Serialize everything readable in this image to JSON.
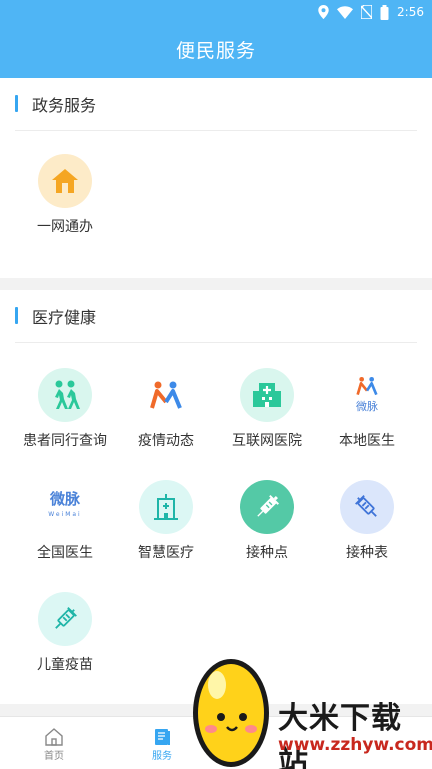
{
  "status": {
    "time": "2:56"
  },
  "header": {
    "title": "便民服务"
  },
  "sections": {
    "gov": {
      "title": "政务服务",
      "items": [
        {
          "label": "一网通办",
          "icon": "home-icon"
        }
      ]
    },
    "med": {
      "title": "医疗健康",
      "items": [
        {
          "label": "患者同行查询",
          "icon": "walking-people-icon"
        },
        {
          "label": "疫情动态",
          "icon": "people-logo-icon"
        },
        {
          "label": "互联网医院",
          "icon": "hospital-icon"
        },
        {
          "label": "本地医生",
          "icon": "weimai-logo-icon"
        },
        {
          "label": "全国医生",
          "icon": "weimai-text-logo"
        },
        {
          "label": "智慧医疗",
          "icon": "smart-building-icon"
        },
        {
          "label": "接种点",
          "icon": "syringe-icon"
        },
        {
          "label": "接种表",
          "icon": "syringe-outline-icon"
        },
        {
          "label": "儿童疫苗",
          "icon": "vaccine-icon"
        }
      ]
    }
  },
  "weimai_logo": {
    "text": "微脉",
    "sub": "WeiMai"
  },
  "tabbar": {
    "tabs": [
      {
        "label": "首页",
        "active": false
      },
      {
        "label": "服务",
        "active": true
      }
    ],
    "active_color": "#36a6f1",
    "inactive_color": "#888888"
  },
  "watermark": {
    "text": "大米下载站",
    "url": "www.zzhyw.com"
  }
}
